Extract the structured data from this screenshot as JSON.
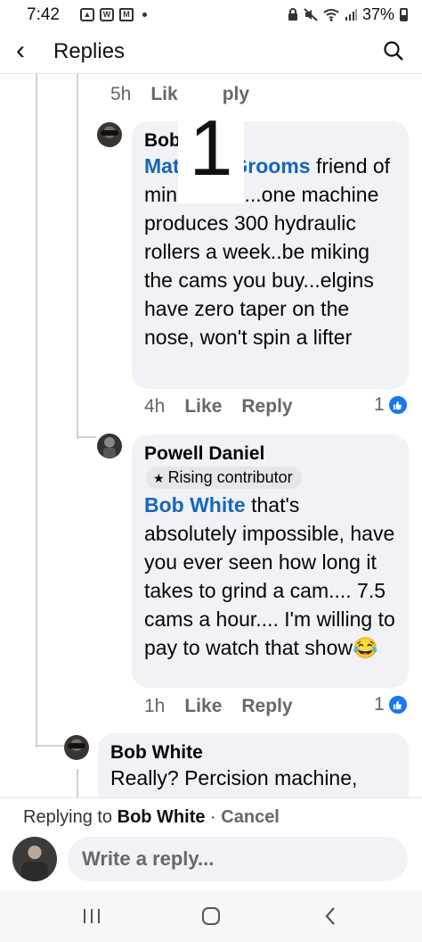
{
  "status_bar": {
    "time": "7:42",
    "battery": "37%",
    "left_icons": [
      "gallery-icon",
      "w-app-icon",
      "gmail-icon",
      "dot-icon"
    ],
    "right_icons": [
      "lock-icon",
      "mute-icon",
      "wifi-icon",
      "signal-icon",
      "battery-icon"
    ]
  },
  "header": {
    "title": "Replies",
    "back_icon": "chevron-left-icon",
    "search_icon": "search-icon"
  },
  "overlay_number": "1",
  "top_meta": {
    "time": "5h",
    "like": "Lik",
    "reply": "ply"
  },
  "comments": [
    {
      "author": "Bob White",
      "mention": "Matthew Grooms",
      "text": " friend of mine has 3...one machine produces 300 hydraulic rollers a week..be miking the cams you buy...elgins have zero taper on the nose, won't spin a lifter",
      "time": "4h",
      "like": "Like",
      "reply": "Reply",
      "reactions": "1"
    },
    {
      "author": "Powell Daniel",
      "badge": "Rising contributor",
      "mention": "Bob White",
      "text": " that's absolutely impossible, have you ever seen how long it takes to grind a cam.... 7.5 cams a hour.... I'm willing to pay to watch that show",
      "emoji": "😂",
      "time": "1h",
      "like": "Like",
      "reply": "Reply",
      "reactions": "1"
    },
    {
      "author": "Bob White",
      "text": "Really? Percision machine,"
    }
  ],
  "composer": {
    "replying_prefix": "Replying to ",
    "replying_name": "Bob White",
    "separator": " · ",
    "cancel": "Cancel",
    "placeholder": "Write a reply..."
  },
  "nav": {
    "icons": [
      "recents-icon",
      "home-icon",
      "back-icon"
    ]
  },
  "colors": {
    "mention": "#1766b8",
    "like_badge": "#1877f2",
    "bubble": "#f0f2f5"
  }
}
